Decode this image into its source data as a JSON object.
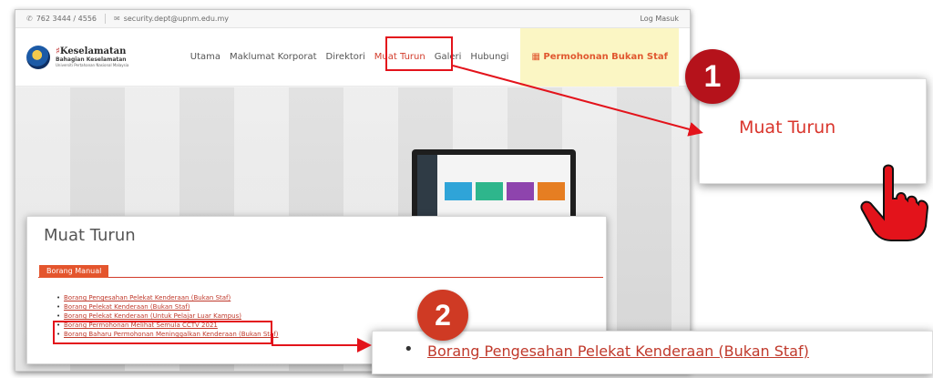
{
  "topbar": {
    "phone": "762 3444 / 4556",
    "email": "security.dept@upnm.edu.my",
    "login": "Log Masuk"
  },
  "logo": {
    "title": "Keselamatan",
    "subtitle": "Bahagian Keselamatan",
    "tagline": "Universiti Pertahanan Nasional Malaysia"
  },
  "nav": {
    "items": [
      "Utama",
      "Maklumat Korporat",
      "Direktori",
      "Muat Turun",
      "Galeri",
      "Hubungi"
    ],
    "permohonan": "Permohonan Bukan Staf"
  },
  "panel": {
    "title": "Muat Turun",
    "tab": "Borang Manual",
    "links": [
      "Borang Pengesahan Pelekat Kenderaan (Bukan Staf)",
      "Borang Pelekat Kenderaan (Bukan Staf)",
      "Borang Pelekat Kenderaan (Untuk Pelajar Luar Kampus)",
      "Borang Permohonan Melihat Semula CCTV 2021",
      "Borang Baharu Permohonan Meninggalkan Kenderaan (Bukan Staf)"
    ]
  },
  "callouts": {
    "step1_number": "1",
    "step1_label": "Muat Turun",
    "step2_number": "2",
    "step2_label": "Borang Pengesahan Pelekat Kenderaan (Bukan Staf)"
  },
  "colors": {
    "accent": "#d23b2a",
    "highlight": "#e3131b",
    "badge1": "#b5121b",
    "badge2": "#cf3a24"
  }
}
